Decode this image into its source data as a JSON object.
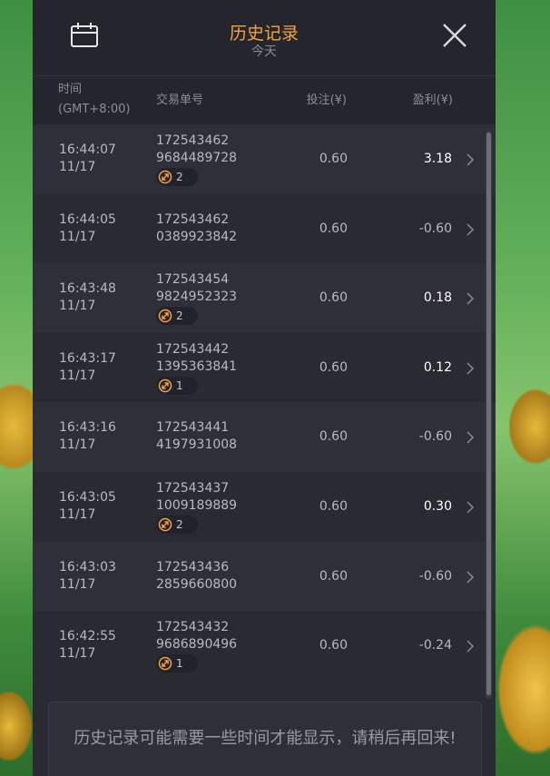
{
  "header": {
    "title": "历史记录",
    "subtitle": "今天",
    "calendar_icon": "calendar-icon",
    "close_icon": "close-icon"
  },
  "columns": {
    "time": "时间",
    "timezone": "(GMT+8:00)",
    "txid": "交易单号",
    "bet": "投注(¥)",
    "profit": "盈利(¥)"
  },
  "rows": [
    {
      "time": "16:44:07",
      "date": "11/17",
      "txid_1": "172543462",
      "txid_2": "9684489728",
      "badge": "2",
      "bet": "0.60",
      "profit": "3.18",
      "positive": true
    },
    {
      "time": "16:44:05",
      "date": "11/17",
      "txid_1": "172543462",
      "txid_2": "0389923842",
      "badge": null,
      "bet": "0.60",
      "profit": "-0.60",
      "positive": false
    },
    {
      "time": "16:43:48",
      "date": "11/17",
      "txid_1": "172543454",
      "txid_2": "9824952323",
      "badge": "2",
      "bet": "0.60",
      "profit": "0.18",
      "positive": true
    },
    {
      "time": "16:43:17",
      "date": "11/17",
      "txid_1": "172543442",
      "txid_2": "1395363841",
      "badge": "1",
      "bet": "0.60",
      "profit": "0.12",
      "positive": true
    },
    {
      "time": "16:43:16",
      "date": "11/17",
      "txid_1": "172543441",
      "txid_2": "4197931008",
      "badge": null,
      "bet": "0.60",
      "profit": "-0.60",
      "positive": false
    },
    {
      "time": "16:43:05",
      "date": "11/17",
      "txid_1": "172543437",
      "txid_2": "1009189889",
      "badge": "2",
      "bet": "0.60",
      "profit": "0.30",
      "positive": true
    },
    {
      "time": "16:43:03",
      "date": "11/17",
      "txid_1": "172543436",
      "txid_2": "2859660800",
      "badge": null,
      "bet": "0.60",
      "profit": "-0.60",
      "positive": false
    },
    {
      "time": "16:42:55",
      "date": "11/17",
      "txid_1": "172543432",
      "txid_2": "9686890496",
      "badge": "1",
      "bet": "0.60",
      "profit": "-0.24",
      "positive": false
    }
  ],
  "notice": "历史记录可能需要一些时间才能显示，请稍后再回来!",
  "colors": {
    "accent": "#f5a242",
    "panel": "#2a2a33",
    "badge_icon": "#f5a242"
  }
}
